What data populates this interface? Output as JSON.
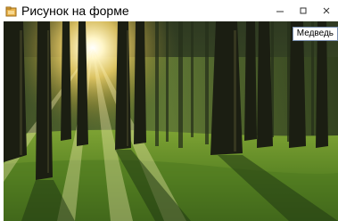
{
  "window": {
    "title": "Рисунок на форме",
    "icon": "form-icon",
    "controls": {
      "minimize_icon": "minimize-icon",
      "maximize_icon": "maximize-icon",
      "close_icon": "close-icon"
    }
  },
  "picture": {
    "subject": "forest-sunrise-photo"
  },
  "label": {
    "text": "Медведь"
  },
  "colors": {
    "frame": "#ffffff",
    "label_border": "#7a8fb0"
  }
}
